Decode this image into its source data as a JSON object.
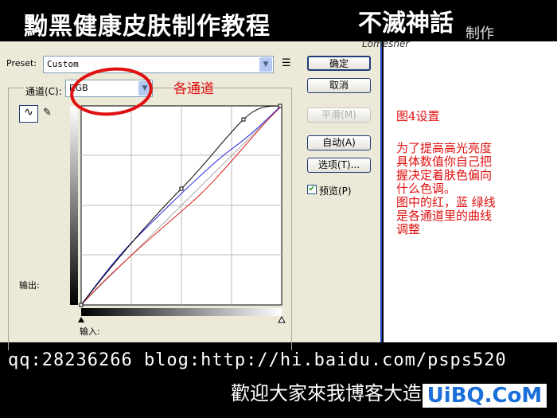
{
  "header": {
    "title": "黝黑健康皮肤制作教程",
    "logo_text": "不滅神話",
    "logo_suffix": "制作",
    "logo_sub": "Lomesher"
  },
  "dialog": {
    "preset_label": "Preset:",
    "preset_value": "Custom",
    "channel_label": "通道(C):",
    "channel_value": "RGB",
    "output_label": "输出:",
    "input_label": "输入:",
    "buttons": {
      "ok": "确定",
      "cancel": "取消",
      "smooth": "平滑(M)",
      "auto": "自动(A)",
      "options": "选项(T)..."
    },
    "preview_label": "预览(P)",
    "preview_checked": true
  },
  "annotation": {
    "channel_note": "各通道",
    "title": "图4设置",
    "lines": [
      "为了提高高光亮度",
      "具体数值你自己把",
      "握决定着肤色偏向",
      "什么色调。",
      "图中的红，蓝 绿线",
      "是各通道里的曲线",
      "调整"
    ]
  },
  "footer": {
    "contact": "qq:28236266  blog:http://hi.baidu.com/psps520",
    "welcome": "歡迎大家來我博客大造・・・",
    "watermark": "UiBQ.CoM"
  },
  "colors": {
    "curve_rgb": "#000000",
    "curve_blue": "#2020e0",
    "curve_red": "#e02020",
    "annotation": "#e01010"
  }
}
